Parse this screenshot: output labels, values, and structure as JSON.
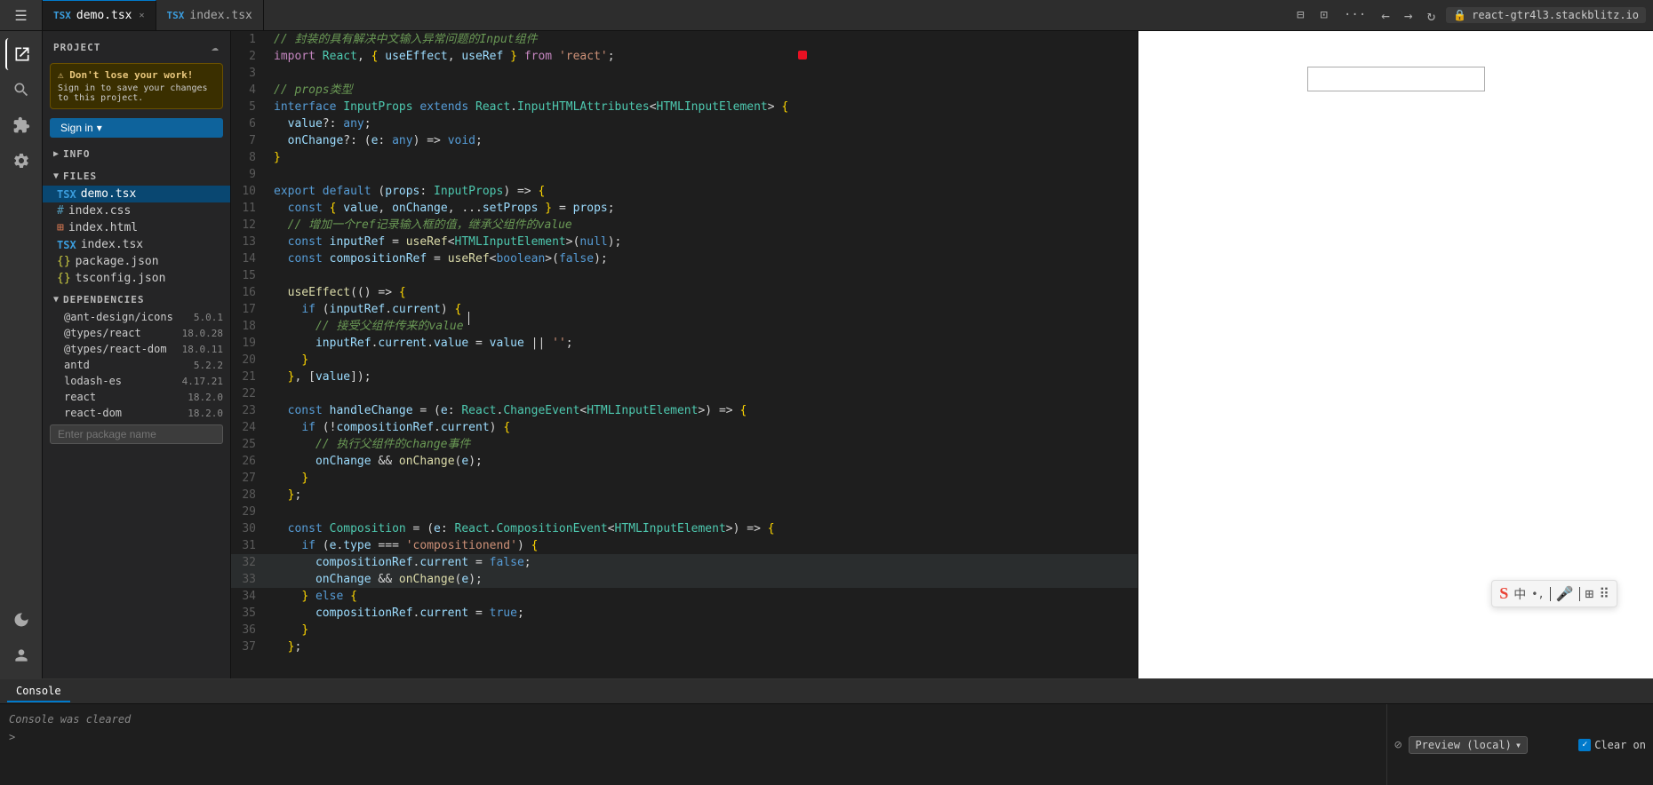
{
  "app": {
    "title": "PROJECT"
  },
  "tabs": [
    {
      "id": "demo-tsx",
      "label": "demo.tsx",
      "icon": "tsx",
      "active": true,
      "closable": true
    },
    {
      "id": "index-tsx",
      "label": "index.tsx",
      "icon": "tsx",
      "active": false,
      "closable": false
    }
  ],
  "toolbar": {
    "nav_back": "←",
    "nav_forward": "→",
    "refresh": "↻",
    "url": "react-gtr4l3.stackblitz.io",
    "lock_icon": "🔒",
    "more": "···",
    "bookmark": "⊟",
    "split": "⊡"
  },
  "sidebar": {
    "project_label": "PROJECT",
    "warning": {
      "title": "⚠ Don't lose your work!",
      "text": "Sign in to save your changes to this project."
    },
    "sign_in_label": "Sign in",
    "info_section": "INFO",
    "files_section": "FILES",
    "files": [
      {
        "name": "demo.tsx",
        "type": "tsx",
        "active": true,
        "indent": 1
      },
      {
        "name": "index.css",
        "type": "css",
        "active": false,
        "indent": 1
      },
      {
        "name": "index.html",
        "type": "html",
        "active": false,
        "indent": 1
      },
      {
        "name": "index.tsx",
        "type": "tsx",
        "active": false,
        "indent": 1
      },
      {
        "name": "package.json",
        "type": "json",
        "active": false,
        "indent": 1
      },
      {
        "name": "tsconfig.json",
        "type": "json",
        "active": false,
        "indent": 1
      }
    ],
    "dependencies_section": "DEPENDENCIES",
    "dependencies": [
      {
        "name": "@ant-design/icons",
        "version": "5.0.1"
      },
      {
        "name": "@types/react",
        "version": "18.0.28"
      },
      {
        "name": "@types/react-dom",
        "version": "18.0.11"
      },
      {
        "name": "antd",
        "version": "5.2.2"
      },
      {
        "name": "lodash-es",
        "version": "4.17.21"
      },
      {
        "name": "react",
        "version": "18.2.0"
      },
      {
        "name": "react-dom",
        "version": "18.2.0"
      }
    ],
    "dep_input_placeholder": "Enter package name"
  },
  "code": {
    "lines": [
      {
        "num": 1,
        "content": "// 封装的具有解决中文输入异常问题的Input组件",
        "type": "comment"
      },
      {
        "num": 2,
        "content": "import React, { useEffect, useRef } from 'react';",
        "type": "code"
      },
      {
        "num": 3,
        "content": "",
        "type": "empty"
      },
      {
        "num": 4,
        "content": "// props类型",
        "type": "comment"
      },
      {
        "num": 5,
        "content": "interface InputProps extends React.InputHTMLAttributes<HTMLInputElement> {",
        "type": "code"
      },
      {
        "num": 6,
        "content": "  value?: any;",
        "type": "code"
      },
      {
        "num": 7,
        "content": "  onChange?: (e: any) => void;",
        "type": "code"
      },
      {
        "num": 8,
        "content": "}",
        "type": "code"
      },
      {
        "num": 9,
        "content": "",
        "type": "empty"
      },
      {
        "num": 10,
        "content": "export default (props: InputProps) => {",
        "type": "code"
      },
      {
        "num": 11,
        "content": "  const { value, onChange, ...setProps } = props;",
        "type": "code"
      },
      {
        "num": 12,
        "content": "  // 增加一个ref记录输入框的值，继承父组件的value",
        "type": "comment"
      },
      {
        "num": 13,
        "content": "  const inputRef = useRef<HTMLInputElement>(null);",
        "type": "code"
      },
      {
        "num": 14,
        "content": "  const compositionRef = useRef<boolean>(false);",
        "type": "code"
      },
      {
        "num": 15,
        "content": "",
        "type": "empty"
      },
      {
        "num": 16,
        "content": "  useEffect(() => {",
        "type": "code"
      },
      {
        "num": 17,
        "content": "    if (inputRef.current) {",
        "type": "code"
      },
      {
        "num": 18,
        "content": "      // 接受父组件传来的value",
        "type": "comment"
      },
      {
        "num": 19,
        "content": "      inputRef.current.value = value || '';",
        "type": "code"
      },
      {
        "num": 20,
        "content": "    }",
        "type": "code"
      },
      {
        "num": 21,
        "content": "  }, [value]);",
        "type": "code"
      },
      {
        "num": 22,
        "content": "",
        "type": "empty"
      },
      {
        "num": 23,
        "content": "  const handleChange = (e: React.ChangeEvent<HTMLInputElement>) => {",
        "type": "code"
      },
      {
        "num": 24,
        "content": "    if (!compositionRef.current) {",
        "type": "code"
      },
      {
        "num": 25,
        "content": "      // 执行父组件的change事件",
        "type": "comment"
      },
      {
        "num": 26,
        "content": "      onChange && onChange(e);",
        "type": "code"
      },
      {
        "num": 27,
        "content": "    }",
        "type": "code"
      },
      {
        "num": 28,
        "content": "  };",
        "type": "code"
      },
      {
        "num": 29,
        "content": "",
        "type": "empty"
      },
      {
        "num": 30,
        "content": "  const Composition = (e: React.CompositionEvent<HTMLInputElement>) => {",
        "type": "code"
      },
      {
        "num": 31,
        "content": "    if (e.type === 'compositionend') {",
        "type": "code"
      },
      {
        "num": 32,
        "content": "      compositionRef.current = false;",
        "type": "code"
      },
      {
        "num": 33,
        "content": "      onChange && onChange(e);",
        "type": "code"
      },
      {
        "num": 34,
        "content": "    } else {",
        "type": "code"
      },
      {
        "num": 35,
        "content": "      compositionRef.current = true;",
        "type": "code"
      },
      {
        "num": 36,
        "content": "    }",
        "type": "code"
      },
      {
        "num": 37,
        "content": "  };",
        "type": "code"
      }
    ]
  },
  "preview": {
    "url": "react-gtr4l3.stackblitz.io",
    "input_placeholder": "",
    "ime_icons": [
      "S",
      "中",
      "•,",
      "🎤",
      "⊞",
      "⠿"
    ]
  },
  "console": {
    "tab_label": "Console",
    "status_icon": "⊘",
    "preview_label": "Preview (local)",
    "clear_on_label": "Clear on",
    "clear_on_checked": true,
    "message": "Console was cleared",
    "arrow": ">"
  }
}
